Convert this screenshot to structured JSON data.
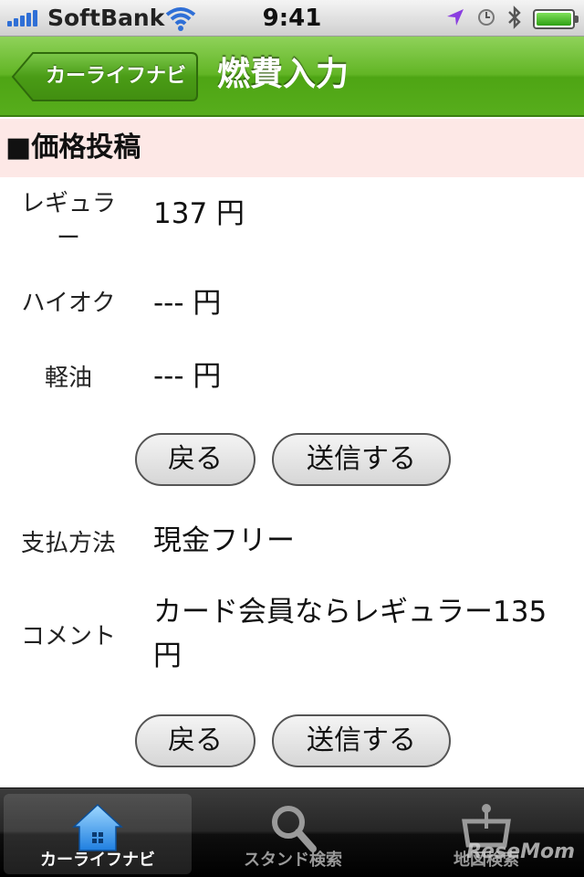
{
  "status_bar": {
    "carrier": "SoftBank",
    "time": "9:41"
  },
  "nav": {
    "back_label": "カーライフナビ",
    "title": "燃費入力"
  },
  "section": {
    "title": "■価格投稿"
  },
  "prices": [
    {
      "label": "レギュラ\nー",
      "value": "137 円"
    },
    {
      "label": "ハイオク",
      "value": "--- 円"
    },
    {
      "label": "軽油",
      "value": "--- 円"
    }
  ],
  "buttons": {
    "back": "戻る",
    "submit": "送信する"
  },
  "details": [
    {
      "label": "支払方法",
      "value": "現金フリー"
    },
    {
      "label": "コメント",
      "value": "カード会員ならレギュラー135\n円"
    }
  ],
  "tabbar": {
    "items": [
      {
        "label": "カーライフナビ",
        "icon": "home-icon",
        "active": true
      },
      {
        "label": "スタンド検索",
        "icon": "search-icon",
        "active": false
      },
      {
        "label": "地図検索",
        "icon": "map-icon",
        "active": false
      }
    ]
  },
  "watermark": "ReseMom",
  "colors": {
    "nav_green": "#5bb01e",
    "section_bg": "#fde8e6",
    "tab_bg": "#1a1a1a"
  }
}
